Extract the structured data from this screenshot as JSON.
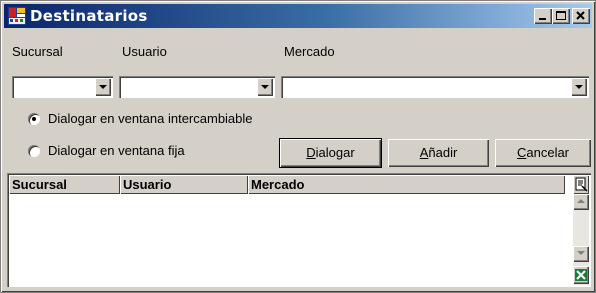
{
  "window": {
    "title": "Destinatarios"
  },
  "filters": {
    "sucursal_label": "Sucursal",
    "usuario_label": "Usuario",
    "mercado_label": "Mercado",
    "sucursal_value": "",
    "usuario_value": "",
    "mercado_value": ""
  },
  "options": {
    "intercambiable_label": "Dialogar en ventana intercambiable",
    "intercambiable_selected": true,
    "fija_label": "Dialogar en ventana fija",
    "fija_selected": false
  },
  "buttons": {
    "dialogar_mn": "D",
    "dialogar_rest": "ialogar",
    "anadir_mn": "A",
    "anadir_rest": "ñadir",
    "cancelar_mn": "C",
    "cancelar_rest": "ancelar"
  },
  "table": {
    "columns": [
      "Sucursal",
      "Usuario",
      "Mercado"
    ],
    "rows": []
  },
  "icons": {
    "app": "app-icon",
    "minimize": "minimize-icon",
    "maximize": "maximize-icon",
    "close": "close-icon",
    "export": "export-icon",
    "excel": "excel-icon"
  },
  "colors": {
    "title_gradient_start": "#0a246a",
    "title_gradient_end": "#a6caf0",
    "face": "#d4d0c8"
  }
}
